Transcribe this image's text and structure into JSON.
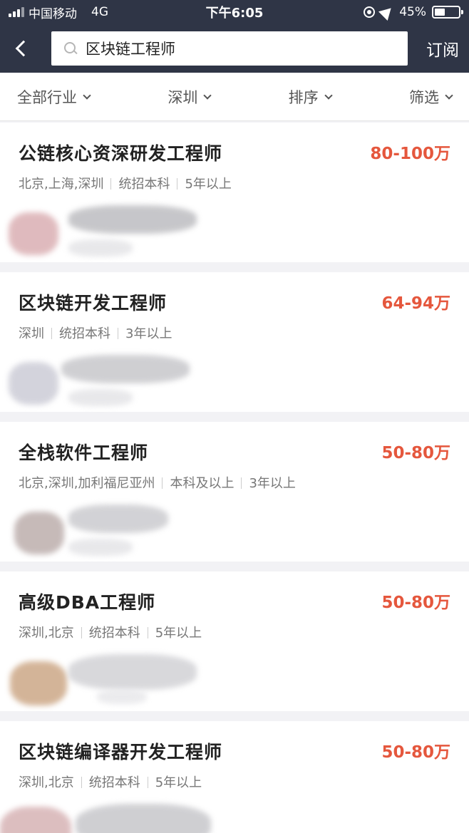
{
  "status": {
    "carrier": "中国移动",
    "network": "4G",
    "time": "下午6:05",
    "battery_text": "45%",
    "battery_level": 0.45
  },
  "search": {
    "back_icon": "chevron-left-icon",
    "value": "区块链工程师",
    "subscribe_label": "订阅"
  },
  "filters": [
    {
      "label": "全部行业"
    },
    {
      "label": "深圳"
    },
    {
      "label": "排序"
    },
    {
      "label": "筛选"
    }
  ],
  "jobs": [
    {
      "title": "公链核心资深研发工程师",
      "salary": "80-100万",
      "tags": [
        "北京,上海,深圳",
        "统招本科",
        "5年以上"
      ]
    },
    {
      "title": "区块链开发工程师",
      "salary": "64-94万",
      "tags": [
        "深圳",
        "统招本科",
        "3年以上"
      ]
    },
    {
      "title": "全栈软件工程师",
      "salary": "50-80万",
      "tags": [
        "北京,深圳,加利福尼亚州",
        "本科及以上",
        "3年以上"
      ]
    },
    {
      "title": "高级DBA工程师",
      "salary": "50-80万",
      "tags": [
        "深圳,北京",
        "统招本科",
        "5年以上"
      ]
    },
    {
      "title": "区块链编译器开发工程师",
      "salary": "50-80万",
      "tags": [
        "深圳,北京",
        "统招本科",
        "5年以上"
      ]
    }
  ],
  "colors": {
    "header_bg": "#2f3546",
    "salary": "#e5573d"
  }
}
